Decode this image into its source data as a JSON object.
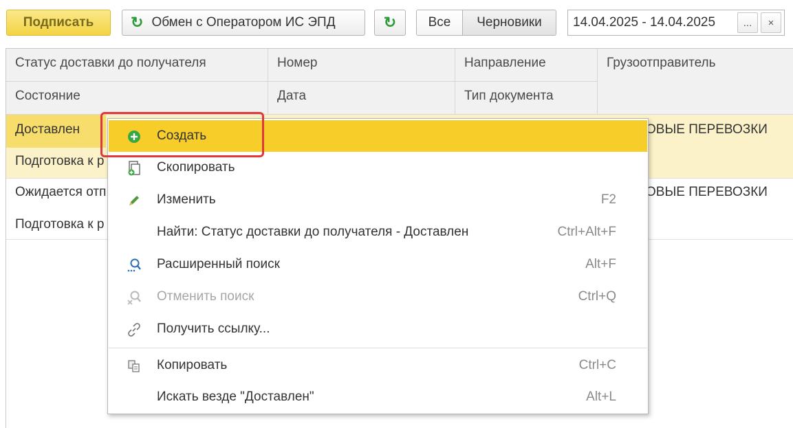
{
  "toolbar": {
    "sign_label": "Подписать",
    "exchange_label": "Обмен с Оператором ИС ЭПД",
    "filter_all": "Все",
    "filter_drafts": "Черновики",
    "period": "14.04.2025 - 14.04.2025",
    "period_select": "...",
    "period_clear": "×"
  },
  "table": {
    "headers": {
      "delivery_status": "Статус доставки до получателя",
      "number": "Номер",
      "direction": "Направление",
      "shipper": "Грузоотправитель",
      "state": "Состояние",
      "date": "Дата",
      "doc_type": "Тип документа"
    },
    "rows": [
      {
        "status": "Доставлен",
        "state": "Подготовка к р",
        "shipper": "ОВЫЕ ПЕРЕВОЗКИ"
      },
      {
        "status": "Ожидается отп",
        "state": "Подготовка к р",
        "shipper": "ОВЫЕ ПЕРЕВОЗКИ"
      }
    ]
  },
  "context_menu": {
    "items": [
      {
        "label": "Создать",
        "shortcut": "",
        "icon": "plus-circle-icon"
      },
      {
        "label": "Скопировать",
        "shortcut": "",
        "icon": "copy-doc-icon"
      },
      {
        "label": "Изменить",
        "shortcut": "F2",
        "icon": "pencil-icon"
      },
      {
        "label": "Найти: Статус доставки до получателя - Доставлен",
        "shortcut": "Ctrl+Alt+F",
        "icon": ""
      },
      {
        "label": "Расширенный поиск",
        "shortcut": "Alt+F",
        "icon": "search-icon"
      },
      {
        "label": "Отменить поиск",
        "shortcut": "Ctrl+Q",
        "icon": "cancel-search-icon"
      },
      {
        "label": "Получить ссылку...",
        "shortcut": "",
        "icon": "link-icon"
      },
      {
        "label": "Копировать",
        "shortcut": "Ctrl+C",
        "icon": "clipboard-icon"
      },
      {
        "label": "Искать везде \"Доставлен\"",
        "shortcut": "Alt+L",
        "icon": ""
      }
    ]
  },
  "colors": {
    "accent": "#f7cd2a",
    "selected_row": "#fcf2c9",
    "highlight_border": "#e0383b",
    "refresh_green": "#2e9b3a"
  }
}
